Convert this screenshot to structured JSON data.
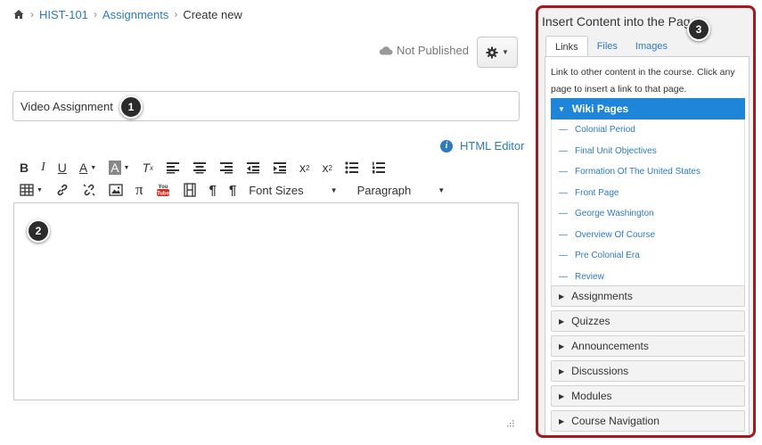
{
  "breadcrumb": {
    "items": [
      "HIST-101",
      "Assignments",
      "Create new"
    ]
  },
  "status": {
    "label": "Not Published"
  },
  "title_input": {
    "value": "Video Assignment"
  },
  "badges": [
    "1",
    "2",
    "3"
  ],
  "editor": {
    "html_editor_label": "HTML Editor",
    "font_sizes_label": "Font Sizes",
    "paragraph_label": "Paragraph"
  },
  "panel": {
    "title": "Insert Content into the Page",
    "tabs": [
      "Links",
      "Files",
      "Images"
    ],
    "help_text": "Link to other content in the course. Click any page to insert a link to that page.",
    "wiki_header": "Wiki Pages",
    "wiki_pages": [
      "Colonial Period",
      "Final Unit Objectives",
      "Formation Of The United States",
      "Front Page",
      "George Washington",
      "Overview Of Course",
      "Pre Colonial Era",
      "Review"
    ],
    "sections": [
      "Assignments",
      "Quizzes",
      "Announcements",
      "Discussions",
      "Modules",
      "Course Navigation"
    ]
  },
  "colors": {
    "link": "#2d7bbf",
    "accent": "#1e85d8",
    "highlight_border": "#a31a22"
  }
}
